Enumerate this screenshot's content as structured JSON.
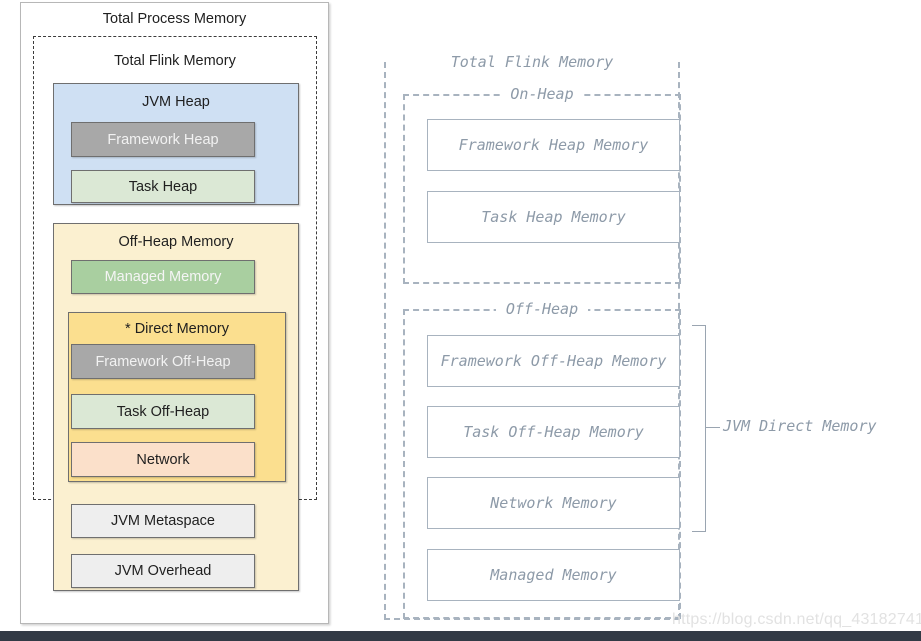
{
  "left_diagram": {
    "outer_label": "Total Process Memory",
    "flink_label": "Total Flink Memory",
    "jvm_heap": {
      "title": "JVM Heap",
      "children": [
        {
          "label": "Framework Heap",
          "color": "#a8a8a8"
        },
        {
          "label": "Task Heap",
          "color": "#dbe8d5"
        }
      ]
    },
    "off_heap": {
      "title": "Off-Heap Memory",
      "managed": {
        "label": "Managed Memory",
        "color": "#a9cfa0"
      },
      "direct": {
        "title": "* Direct Memory",
        "children": [
          {
            "label": "Framework Off-Heap",
            "color": "#a8a8a8"
          },
          {
            "label": "Task Off-Heap",
            "color": "#dbe8d5"
          },
          {
            "label": "Network",
            "color": "#fbe0ca"
          }
        ]
      }
    },
    "jvm_metaspace": {
      "label": "JVM Metaspace",
      "color": "#eeeeee"
    },
    "jvm_overhead": {
      "label": "JVM Overhead",
      "color": "#eeeeee"
    }
  },
  "right_diagram": {
    "outer_label": "Total Flink Memory",
    "on_heap": {
      "label": "On-Heap",
      "boxes": [
        {
          "label": "Framework Heap Memory"
        },
        {
          "label": "Task Heap Memory"
        }
      ]
    },
    "off_heap": {
      "label": "Off-Heap",
      "boxes": [
        {
          "label": "Framework Off-Heap Memory"
        },
        {
          "label": "Task Off-Heap Memory"
        },
        {
          "label": "Network Memory"
        },
        {
          "label": "Managed Memory"
        }
      ]
    },
    "bracket_label": "JVM Direct Memory"
  },
  "watermark": "https://blog.csdn.net/qq_43182741",
  "colors": {
    "jvm_heap_bg": "#cfe0f3",
    "off_heap_bg": "#fbf0d0",
    "direct_mem_bg": "#fbdf8f",
    "ascii_line": "#a8b3bf",
    "ascii_text": "#8d9aa8",
    "bottom_bar": "#323a45"
  }
}
